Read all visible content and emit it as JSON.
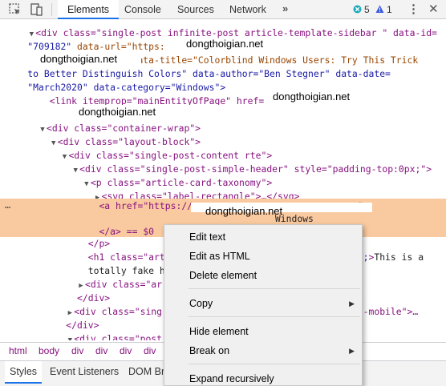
{
  "toolbar": {
    "tabs": [
      "Elements",
      "Console",
      "Sources",
      "Network"
    ],
    "more_tabs": "»",
    "error_count": "5",
    "warning_count": "1",
    "icons": [
      "inspect-icon",
      "device-toggle-icon",
      "error-icon",
      "warning-icon",
      "kebab-menu-icon",
      "close-icon"
    ],
    "accent_color": "#1a73e8"
  },
  "watermark": "dongthoigian.net",
  "dom": {
    "l0_attr_value": "\"709182\"",
    "l0": "data-url=\"https:/",
    "l1a": "data-title=\"Colorblind Windows Users: Try This Trick",
    "l2": "to Better Distinguish Colors\" data-author=\"Ben Stegner\" data-date=",
    "l3": "\"March2020\" data-category=\"Windows\">",
    "l4_tag": "<link itemprop=\"mainEntityOfPage\" href=\"",
    "l4_end": "\">",
    "l5": "<div class=\"container-wrap\">",
    "l6": "<div class=\"layout-block\">",
    "l7": "<div class=\"single-post-content rte\">",
    "l8": "<div class=\"single-post-simple-header\" style=\"padding-top:0px;\">",
    "l9": "<p class=\"article-card-taxonomy\">",
    "l10": "<svg class=\"label-rectangle\">…</svg>",
    "sel_a": "<a href=\"https://",
    "sel_a_end": "\">",
    "sel_text": "Windows",
    "sel_close": "</a> == $0",
    "l12": "</p>",
    "l13a": "<h1 class=\"art",
    "l13b": "o;\">This is a",
    "l14": "totally fake h",
    "l15": "<div class=\"ar",
    "l16": "</div>",
    "l17a": "<div class=\"sing",
    "l17b": "-mobile\">…",
    "l18": "</div>",
    "l19": "<div class=\"post",
    "l_top": "<div class=\"single-post infinite-post article-template-sidebar \" data-id="
  },
  "breadcrumbs": [
    "html",
    "body",
    "div",
    "div",
    "div",
    "div"
  ],
  "bottom_tabs": [
    "Styles",
    "Event Listeners",
    "DOM Br"
  ],
  "context_menu": {
    "items": [
      {
        "label": "Edit text",
        "submenu": false
      },
      {
        "label": "Edit as HTML",
        "submenu": false
      },
      {
        "label": "Delete element",
        "submenu": false
      },
      {
        "label": "Copy",
        "submenu": true
      },
      {
        "label": "Hide element",
        "submenu": false
      },
      {
        "label": "Break on",
        "submenu": true
      },
      {
        "label": "Expand recursively",
        "submenu": false
      }
    ]
  },
  "selection_color": "#f9c99f"
}
